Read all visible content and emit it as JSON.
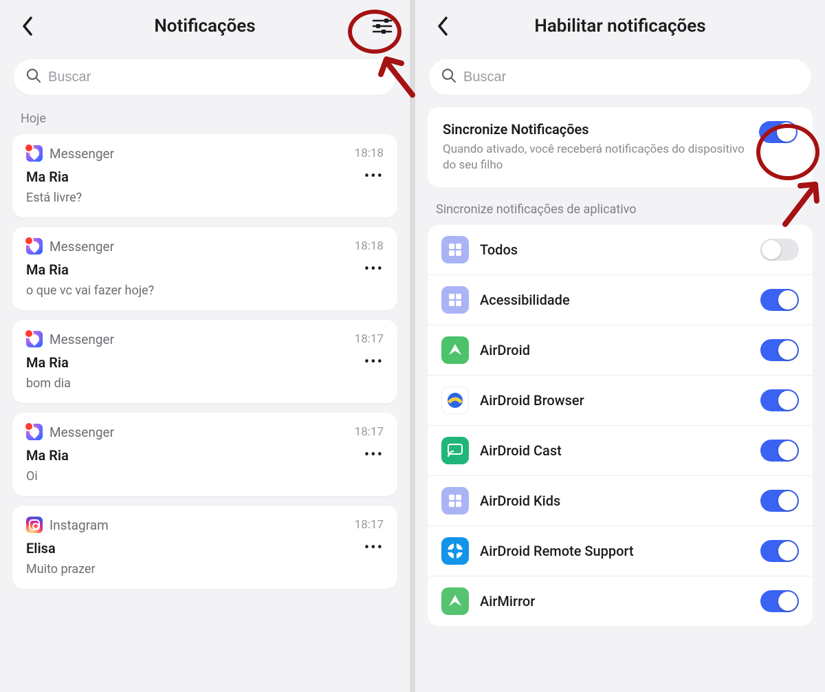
{
  "left": {
    "title": "Notificações",
    "search_placeholder": "Buscar",
    "section_today": "Hoje",
    "notifications": [
      {
        "app": "Messenger",
        "icon": "messenger",
        "time": "18:18",
        "sender": "Ma Ria",
        "message": "Está livre?"
      },
      {
        "app": "Messenger",
        "icon": "messenger",
        "time": "18:18",
        "sender": "Ma Ria",
        "message": "o que vc vai fazer hoje?"
      },
      {
        "app": "Messenger",
        "icon": "messenger",
        "time": "18:17",
        "sender": "Ma Ria",
        "message": "bom dia"
      },
      {
        "app": "Messenger",
        "icon": "messenger",
        "time": "18:17",
        "sender": "Ma Ria",
        "message": "Oi"
      },
      {
        "app": "Instagram",
        "icon": "instagram",
        "time": "18:17",
        "sender": "Elisa",
        "message": "Muito prazer"
      }
    ]
  },
  "right": {
    "title": "Habilitar notificações",
    "search_placeholder": "Buscar",
    "sync_title": "Sincronize Notificações",
    "sync_desc": "Quando ativado, você receberá notificações do dispositivo do seu filho",
    "sync_enabled": true,
    "section_apps": "Sincronize notificações de aplicativo",
    "apps": [
      {
        "name": "Todos",
        "icon": "grid",
        "enabled": false
      },
      {
        "name": "Acessibilidade",
        "icon": "grid",
        "enabled": true
      },
      {
        "name": "AirDroid",
        "icon": "airdroid",
        "enabled": true
      },
      {
        "name": "AirDroid Browser",
        "icon": "airdroid-browser",
        "enabled": true
      },
      {
        "name": "AirDroid Cast",
        "icon": "airdroid-cast",
        "enabled": true
      },
      {
        "name": "AirDroid Kids",
        "icon": "grid",
        "enabled": true
      },
      {
        "name": "AirDroid Remote Support",
        "icon": "airdroid-remote",
        "enabled": true
      },
      {
        "name": "AirMirror",
        "icon": "airmirror",
        "enabled": true
      }
    ]
  },
  "annotation": {
    "color": "#a51212"
  }
}
